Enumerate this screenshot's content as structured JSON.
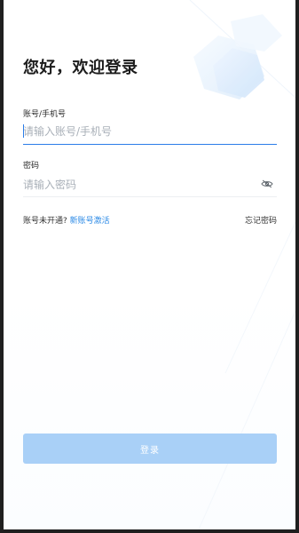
{
  "login": {
    "title": "您好，欢迎登录",
    "account": {
      "label": "账号/手机号",
      "placeholder": "请输入账号/手机号",
      "value": ""
    },
    "password": {
      "label": "密码",
      "placeholder": "请输入密码",
      "value": ""
    },
    "not_activated_text": "账号未开通?",
    "activate_link": "新账号激活",
    "forgot_password": "忘记密码",
    "submit_button": "登录"
  },
  "icons": {
    "password_visibility": "eye-off-icon",
    "decor": "abstract-shape-illustration"
  },
  "colors": {
    "accent": "#2b8ae6",
    "focused_underline": "#2b7de9",
    "button_disabled_bg": "#a9d0f7",
    "text_primary": "#1c1c1c",
    "placeholder": "#a9b0b8"
  }
}
